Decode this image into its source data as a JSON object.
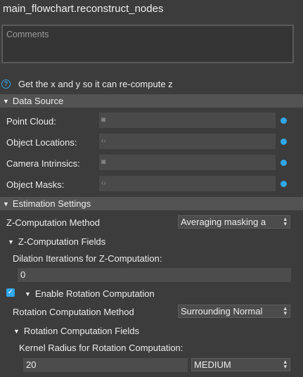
{
  "title": "main_flowchart.reconstruct_nodes",
  "comments_placeholder": "Comments",
  "description": "Get the x and y so it can re-compute z",
  "data_source": {
    "header": "Data Source",
    "rows": [
      {
        "label": "Point Cloud:",
        "icon": "camera-icon",
        "glyph": "◙"
      },
      {
        "label": "Object Locations:",
        "icon": "code-brackets-icon",
        "glyph": "‹›"
      },
      {
        "label": "Camera Intrinsics:",
        "icon": "camera-icon",
        "glyph": "◙"
      },
      {
        "label": "Object Masks:",
        "icon": "code-brackets-icon",
        "glyph": "‹›"
      }
    ]
  },
  "estimation": {
    "header": "Estimation Settings",
    "z_method_label": "Z-Computation Method",
    "z_method_value": "Averaging masking a",
    "z_fields_header": "Z-Computation Fields",
    "dilation_label": "Dilation Iterations for Z-Computation:",
    "dilation_value": "0",
    "enable_rotation_label": "Enable Rotation Computation",
    "enable_rotation_checked": true,
    "rotation_method_label": "Rotation Computation Method",
    "rotation_method_value": "Surrounding Normal",
    "rotation_fields_header": "Rotation Computation Fields",
    "kernel_label": "Kernel Radius for Rotation Computation:",
    "kernel_value": "20",
    "kernel_size_value": "MEDIUM"
  },
  "colors": {
    "background": "#3c3c3c",
    "section_header": "#535353",
    "accent": "#2fa7e8"
  }
}
